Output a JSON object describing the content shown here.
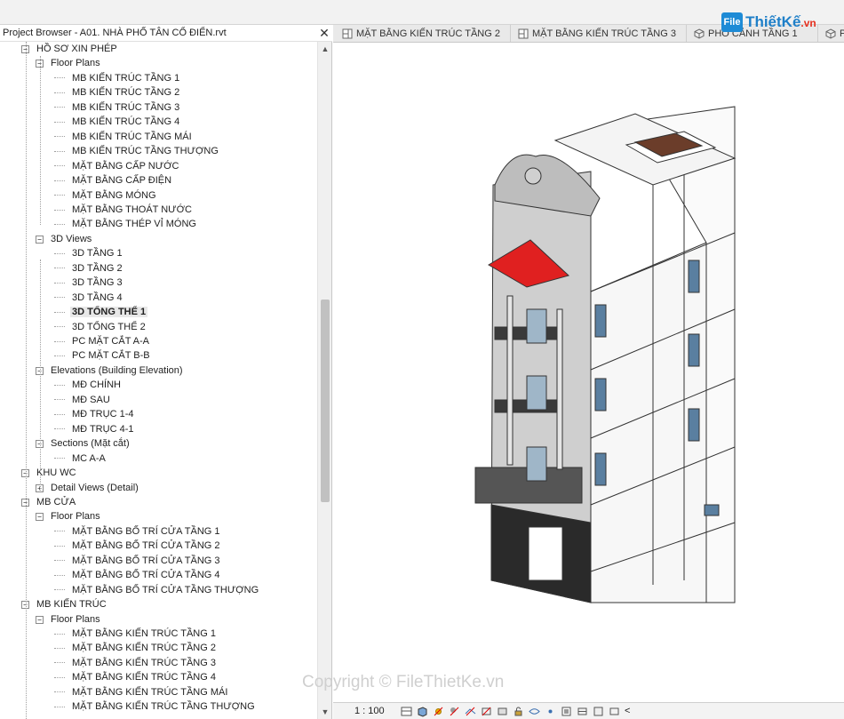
{
  "browser": {
    "title": "Project Browser - A01. NHÀ PHỐ TÂN CỔ ĐIỂN.rvt",
    "close": "✕"
  },
  "tree": [
    {
      "label": "HỒ SƠ XIN PHÉP",
      "level": 1,
      "toggle": "−"
    },
    {
      "label": "Floor Plans",
      "level": 2,
      "toggle": "−"
    },
    {
      "label": "MB KIẾN TRÚC TẦNG 1",
      "level": 3
    },
    {
      "label": "MB KIẾN TRÚC TẦNG 2",
      "level": 3
    },
    {
      "label": "MB KIẾN TRÚC TẦNG 3",
      "level": 3
    },
    {
      "label": "MB KIẾN TRÚC TẦNG 4",
      "level": 3
    },
    {
      "label": "MB KIẾN TRÚC TẦNG MÁI",
      "level": 3
    },
    {
      "label": "MB KIẾN TRÚC TẦNG THƯỢNG",
      "level": 3
    },
    {
      "label": "MẶT BẰNG CẤP NƯỚC",
      "level": 3
    },
    {
      "label": "MẶT BẰNG CẤP ĐIỆN",
      "level": 3
    },
    {
      "label": "MẶT BẰNG MÓNG",
      "level": 3
    },
    {
      "label": "MẶT BẰNG THOÁT NƯỚC",
      "level": 3
    },
    {
      "label": "MẶT BẰNG THÉP VỈ MÓNG",
      "level": 3
    },
    {
      "label": "3D Views",
      "level": 2,
      "toggle": "−"
    },
    {
      "label": "3D TẦNG 1",
      "level": 3
    },
    {
      "label": "3D TẦNG 2",
      "level": 3
    },
    {
      "label": "3D TẦNG 3",
      "level": 3
    },
    {
      "label": "3D TẦNG 4",
      "level": 3
    },
    {
      "label": "3D TỔNG THỂ 1",
      "level": 3,
      "bold": true
    },
    {
      "label": "3D TỔNG THỂ 2",
      "level": 3
    },
    {
      "label": "PC MẶT CẮT A-A",
      "level": 3
    },
    {
      "label": "PC MẶT CẮT B-B",
      "level": 3
    },
    {
      "label": "Elevations (Building Elevation)",
      "level": 2,
      "toggle": "−"
    },
    {
      "label": "MĐ CHÍNH",
      "level": 3
    },
    {
      "label": "MĐ SAU",
      "level": 3
    },
    {
      "label": "MĐ TRỤC 1-4",
      "level": 3
    },
    {
      "label": "MĐ TRỤC 4-1",
      "level": 3
    },
    {
      "label": "Sections (Mặt cắt)",
      "level": 2,
      "toggle": "−"
    },
    {
      "label": "MC A-A",
      "level": 3
    },
    {
      "label": "KHU WC",
      "level": 1,
      "toggle": "−"
    },
    {
      "label": "Detail Views (Detail)",
      "level": 2,
      "toggle": "+"
    },
    {
      "label": "MB CỬA",
      "level": 1,
      "toggle": "−"
    },
    {
      "label": "Floor Plans",
      "level": 2,
      "toggle": "−"
    },
    {
      "label": "MẶT BẰNG BỐ TRÍ CỬA TẦNG 1",
      "level": 3
    },
    {
      "label": "MẶT BẰNG BỐ TRÍ CỬA TẦNG 2",
      "level": 3
    },
    {
      "label": "MẶT BẰNG BỐ TRÍ CỬA TẦNG 3",
      "level": 3
    },
    {
      "label": "MẶT BẰNG BỐ TRÍ CỬA TẦNG 4",
      "level": 3
    },
    {
      "label": "MẶT BẰNG BỐ TRÍ CỬA TẦNG THƯỢNG",
      "level": 3
    },
    {
      "label": "MB KIẾN TRÚC",
      "level": 1,
      "toggle": "−"
    },
    {
      "label": "Floor Plans",
      "level": 2,
      "toggle": "−"
    },
    {
      "label": "MẶT BẰNG KIẾN TRÚC TẦNG 1",
      "level": 3
    },
    {
      "label": "MẶT BẰNG KIẾN TRÚC TẦNG 2",
      "level": 3
    },
    {
      "label": "MẶT BẰNG KIẾN TRÚC TẦNG 3",
      "level": 3
    },
    {
      "label": "MẶT BẰNG KIẾN TRÚC TẦNG 4",
      "level": 3
    },
    {
      "label": "MẶT BẰNG KIẾN TRÚC TẦNG MÁI",
      "level": 3
    },
    {
      "label": "MẶT BẰNG KIẾN TRÚC TẦNG THƯỢNG",
      "level": 3
    }
  ],
  "tabs": [
    {
      "label": "MẶT BẰNG KIẾN TRÚC TẦNG 2",
      "icon": "floor-plan-icon"
    },
    {
      "label": "MẶT BẰNG KIẾN TRÚC TẦNG 3",
      "icon": "floor-plan-icon"
    },
    {
      "label": "PHỐ CẢNH TẦNG 1",
      "icon": "3d-view-icon"
    },
    {
      "label": "P",
      "icon": "3d-view-icon"
    }
  ],
  "status": {
    "scale": "1 : 100"
  },
  "watermark": {
    "logo_badge": "File",
    "logo_text": "ThiếtKế",
    "logo_ext": ".vn",
    "copyright": "Copyright © FileThietKe.vn"
  },
  "colors": {
    "roof_red": "#e02020",
    "building_dark": "#2a2a2a",
    "accent_blue": "#1e8bd6"
  }
}
